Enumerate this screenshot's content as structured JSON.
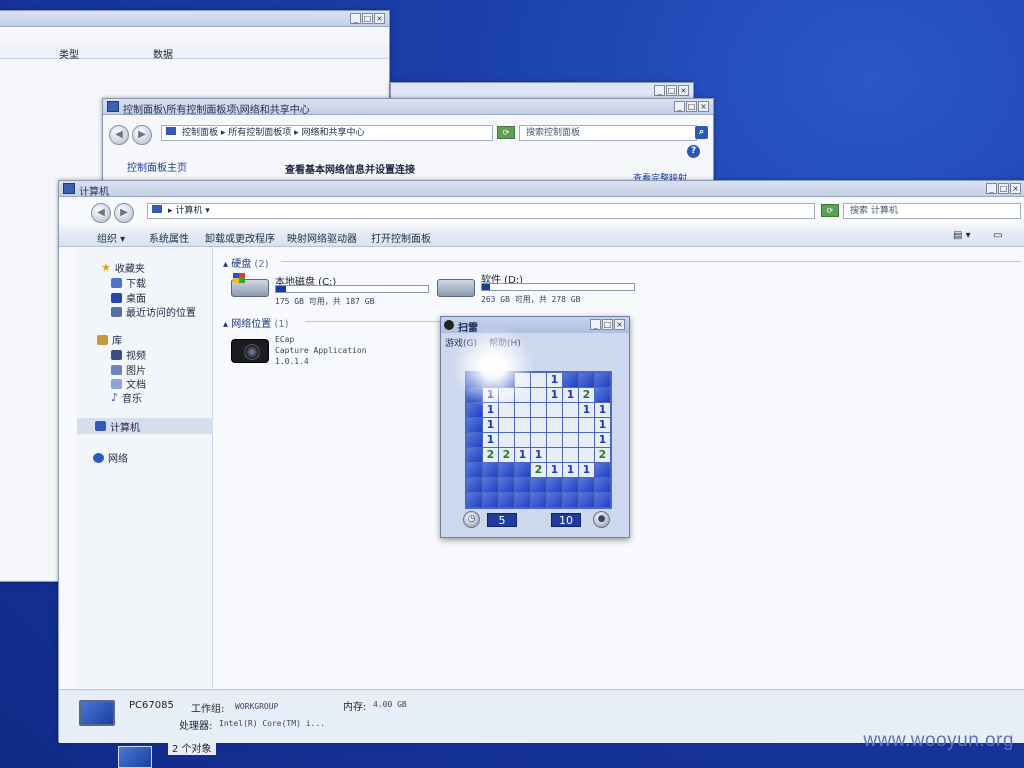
{
  "back_window_left": {
    "col_type": "类型",
    "col_data": "数据",
    "controls": [
      "_",
      "□",
      "×"
    ]
  },
  "network_window": {
    "title": "控制面板\\所有控制面板项\\网络和共享中心",
    "breadcrumb": [
      "控制面板",
      "所有控制面板项",
      "网络和共享中心"
    ],
    "search_placeholder": "搜索控制面板",
    "sidebar_link": "控制面板主页",
    "heading": "查看基本网络信息并设置连接",
    "side_link_partial": "查看完整映射",
    "controls": [
      "_",
      "□",
      "×"
    ]
  },
  "computer_window": {
    "title": "计算机",
    "address": "计算机",
    "search_placeholder": "搜索 计算机",
    "controls": [
      "_",
      "□",
      "×"
    ],
    "commands": {
      "organize": "组织 ▾",
      "system_properties": "系统属性",
      "uninstall": "卸载或更改程序",
      "map_drive": "映射网络驱动器",
      "open_control_panel": "打开控制面板"
    },
    "nav": {
      "favorites": "收藏夹",
      "downloads": "下载",
      "desktop": "桌面",
      "recent": "最近访问的位置",
      "libraries": "库",
      "videos": "视频",
      "pictures": "图片",
      "documents": "文档",
      "music": "音乐",
      "computer": "计算机",
      "network": "网络"
    },
    "hard_disks": {
      "heading": "硬盘",
      "count": "(2)",
      "drives": [
        {
          "name": "本地磁盘 (C:)",
          "free_text": "175 GB 可用，共 187 GB",
          "used_fraction": 0.064
        },
        {
          "name": "软件 (D:)",
          "free_text": "263 GB 可用，共 278 GB",
          "used_fraction": 0.054
        }
      ]
    },
    "network_locations": {
      "heading": "网络位置",
      "count": "(1)",
      "item_name": "ECap",
      "item_line2": "Capture Application",
      "item_line3": "1.0.1.4"
    },
    "status": {
      "pc_name": "PC67085",
      "workgroup_label": "工作组:",
      "workgroup": "WORKGROUP",
      "memory_label": "内存:",
      "memory": "4.00 GB",
      "cpu_label": "处理器:",
      "cpu": "Intel(R) Core(TM) i...",
      "objects": "2 个对象"
    }
  },
  "minesweeper": {
    "title": "扫雷",
    "menu_game": "游戏(G)",
    "menu_help": "帮助(H)",
    "controls": [
      "_",
      "□",
      "×"
    ],
    "time": "5",
    "mines": "10",
    "grid": [
      [
        "h",
        "h",
        "h",
        "o",
        "o",
        "1",
        "h",
        "h",
        "h"
      ],
      [
        "h",
        "1",
        "o",
        "o",
        "o",
        "1",
        "1",
        "2",
        "h"
      ],
      [
        "h",
        "1",
        "o",
        "o",
        "o",
        "o",
        "o",
        "1",
        "1"
      ],
      [
        "h",
        "1",
        "o",
        "o",
        "o",
        "o",
        "o",
        "o",
        "1"
      ],
      [
        "h",
        "1",
        "o",
        "o",
        "o",
        "o",
        "o",
        "o",
        "1"
      ],
      [
        "h",
        "2",
        "2",
        "1",
        "1",
        "o",
        "o",
        "o",
        "2"
      ],
      [
        "h",
        "h",
        "h",
        "h",
        "2",
        "1",
        "1",
        "1",
        "h"
      ],
      [
        "h",
        "h",
        "h",
        "h",
        "h",
        "h",
        "h",
        "h",
        "h"
      ],
      [
        "h",
        "h",
        "h",
        "h",
        "h",
        "h",
        "h",
        "h",
        "h"
      ]
    ]
  },
  "watermark": "www.wooyun.org"
}
